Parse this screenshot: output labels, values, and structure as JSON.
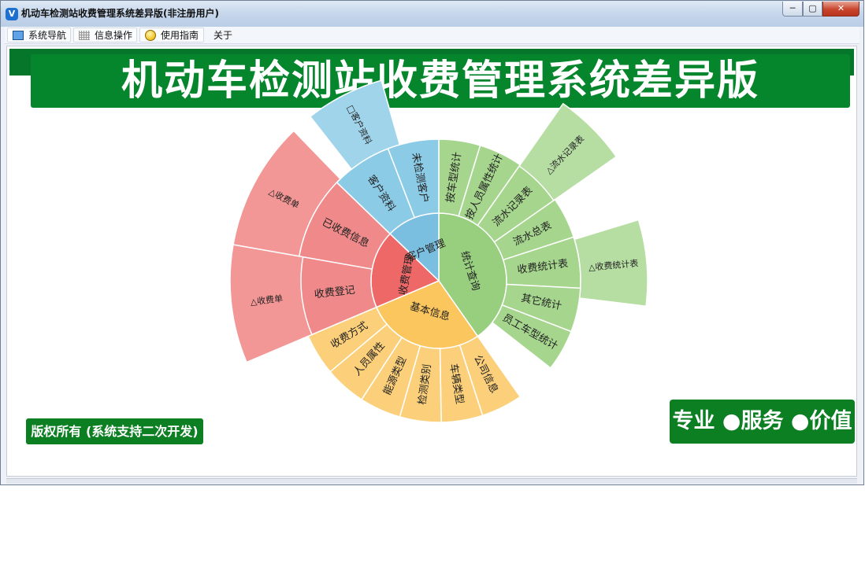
{
  "window": {
    "title": "机动车检测站收费管理系统差异版(非注册用户)",
    "controls": {
      "minimize": "─",
      "maximize": "▢",
      "close": "✕"
    }
  },
  "menu": [
    {
      "label": "系统导航",
      "icon": "monitor-icon"
    },
    {
      "label": "信息操作",
      "icon": "grid-icon"
    },
    {
      "label": "使用指南",
      "icon": "help-icon"
    },
    {
      "label": "关于",
      "icon": ""
    }
  ],
  "banner": {
    "title": "机动车检测站收费管理系统差异版"
  },
  "footer": {
    "copyright": "版权所有 (系统支持二次开发)"
  },
  "slogan": {
    "text": "专业 ●服务 ●价值"
  },
  "colors": {
    "accent_green": "#06862c",
    "stats": "#97cf7f",
    "client": "#7bbfe0",
    "fees": "#ee6868",
    "basic": "#fbc65e"
  },
  "sunburst": [
    {
      "label": "统计查询",
      "color": "#97cf7f",
      "children": [
        {
          "label": "按车型统计",
          "color": "#a6d68e"
        },
        {
          "label": "按人员属性统计",
          "color": "#a6d68e"
        },
        {
          "label": "流水记录表",
          "color": "#a6d68e",
          "children": [
            {
              "label": "△流水记录表",
              "color": "#b6dea3"
            }
          ]
        },
        {
          "label": "流水总表",
          "color": "#a6d68e"
        },
        {
          "label": "收费统计表",
          "color": "#a6d68e",
          "children": [
            {
              "label": "△收费统计表",
              "color": "#b6dea3"
            }
          ]
        },
        {
          "label": "其它统计",
          "color": "#a6d68e"
        },
        {
          "label": "员工车型统计",
          "color": "#a6d68e"
        }
      ]
    },
    {
      "label": "基本信息",
      "color": "#fbc65e",
      "children": [
        {
          "label": "公司信息",
          "color": "#fcd07a"
        },
        {
          "label": "车辆类型",
          "color": "#fcd07a"
        },
        {
          "label": "检测类别",
          "color": "#fcd07a"
        },
        {
          "label": "能源类型",
          "color": "#fcd07a"
        },
        {
          "label": "人员属性",
          "color": "#fcd07a"
        },
        {
          "label": "收费方式",
          "color": "#fcd07a"
        }
      ]
    },
    {
      "label": "收费管理",
      "color": "#ee6868",
      "children": [
        {
          "label": "收费登记",
          "color": "#f08a8a",
          "children": [
            {
              "label": "△收费单",
              "color": "#f29696"
            }
          ]
        },
        {
          "label": "已收费信息",
          "color": "#f08a8a",
          "children": [
            {
              "label": "△收费单",
              "color": "#f29696"
            }
          ]
        }
      ]
    },
    {
      "label": "客户管理",
      "color": "#7bbfe0",
      "children": [
        {
          "label": "客户资料",
          "color": "#8ccbe6",
          "children": [
            {
              "label": "□客户资料",
              "color": "#9fd4ea"
            }
          ]
        },
        {
          "label": "未检测客户",
          "color": "#8ccbe6"
        }
      ]
    }
  ]
}
